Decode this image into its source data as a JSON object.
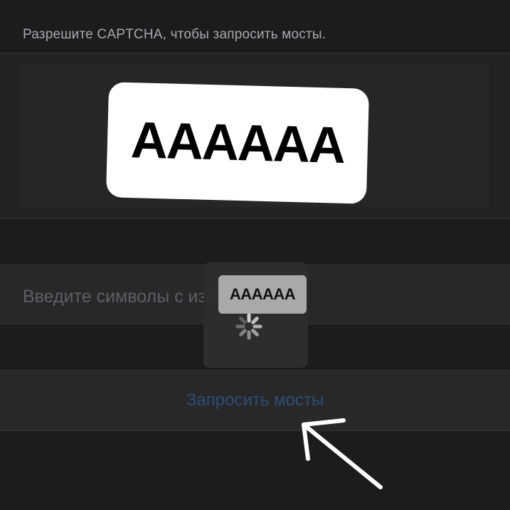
{
  "instruction": "Разрешите CAPTCHA, чтобы запросить мосты.",
  "captcha": {
    "text": "AAAAAA"
  },
  "input": {
    "placeholder": "Введите символы с изображения"
  },
  "request_button": {
    "label": "Запросить мосты"
  },
  "popup": {
    "label": "AAAAAA"
  },
  "colors": {
    "background": "#1c1c1e",
    "section": "#28282a",
    "accent_link": "#2c4e73",
    "captcha_bg": "#ffffff"
  },
  "icons": {
    "spinner": "loading-spinner-icon",
    "arrow": "pointer-arrow-icon"
  }
}
